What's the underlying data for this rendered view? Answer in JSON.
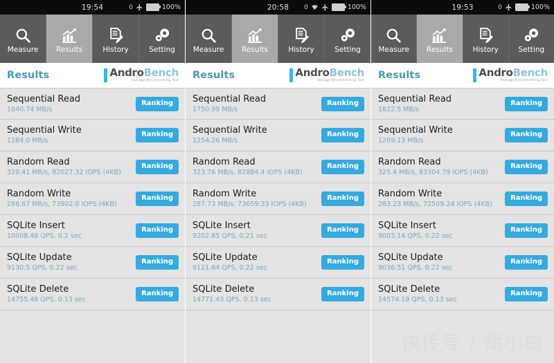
{
  "app": {
    "title": "Results",
    "logo": {
      "part1": "Andro",
      "part2": "Bench",
      "tagline": "Storage Benchmarking Tool",
      "bar_color": "#38b8e0",
      "part1_color": "#4c4c4c",
      "part2_color": "#8fc6dd"
    },
    "accent_color": "#35aade",
    "title_color": "#4a9ab0",
    "value_color": "#79a9c4",
    "tab_active_bg": "#a9a9a9",
    "tab_bg": "#5b5b5b",
    "list_bg": "#e4e4e4"
  },
  "tabs": [
    {
      "label": "Measure",
      "icon": "search-icon",
      "active": false
    },
    {
      "label": "Results",
      "icon": "bar-chart-icon",
      "active": true
    },
    {
      "label": "History",
      "icon": "document-pen-icon",
      "active": false
    },
    {
      "label": "Setting",
      "icon": "gears-icon",
      "active": false
    }
  ],
  "ranking_label": "Ranking",
  "watermark": "快传号 / 胡小白",
  "panels": [
    {
      "status": {
        "time": "19:54",
        "zero": "0",
        "wifi": false,
        "airplane": true,
        "battery": "100%"
      },
      "rows": [
        {
          "title": "Sequential Read",
          "value": "1840.74 MB/s"
        },
        {
          "title": "Sequential Write",
          "value": "1284.0 MB/s"
        },
        {
          "title": "Random Read",
          "value": "320.41 MB/s, 82027.32 IOPS (4KB)"
        },
        {
          "title": "Random Write",
          "value": "288.67 MB/s, 73902.0 IOPS (4KB)"
        },
        {
          "title": "SQLite Insert",
          "value": "10008.48 QPS, 0.2 sec"
        },
        {
          "title": "SQLite Update",
          "value": "9130.5 QPS, 0.22 sec"
        },
        {
          "title": "SQLite Delete",
          "value": "14755.48 QPS, 0.13 sec"
        }
      ]
    },
    {
      "status": {
        "time": "20:58",
        "zero": "0",
        "wifi": true,
        "airplane": true,
        "battery": "100%"
      },
      "rows": [
        {
          "title": "Sequential Read",
          "value": "1750.99 MB/s"
        },
        {
          "title": "Sequential Write",
          "value": "1254.26 MB/s"
        },
        {
          "title": "Random Read",
          "value": "323.76 MB/s, 82884.4 IOPS (4KB)"
        },
        {
          "title": "Random Write",
          "value": "287.73 MB/s, 73659.33 IOPS (4KB)"
        },
        {
          "title": "SQLite Insert",
          "value": "9202.85 QPS, 0.21 sec"
        },
        {
          "title": "SQLite Update",
          "value": "9121.64 QPS, 0.22 sec"
        },
        {
          "title": "SQLite Delete",
          "value": "14771.43 QPS, 0.13 sec"
        }
      ]
    },
    {
      "status": {
        "time": "19:53",
        "zero": "0",
        "wifi": false,
        "airplane": true,
        "battery": "100%"
      },
      "rows": [
        {
          "title": "Sequential Read",
          "value": "1822.5 MB/s"
        },
        {
          "title": "Sequential Write",
          "value": "1269.13 MB/s"
        },
        {
          "title": "Random Read",
          "value": "325.4 MB/s, 83304.79 IOPS (4KB)"
        },
        {
          "title": "Random Write",
          "value": "283.23 MB/s, 72509.24 IOPS (4KB)"
        },
        {
          "title": "SQLite Insert",
          "value": "9003.14 QPS, 0.22 sec"
        },
        {
          "title": "SQLite Update",
          "value": "9036.51 QPS, 0.22 sec"
        },
        {
          "title": "SQLite Delete",
          "value": "14574.19 QPS, 0.13 sec"
        }
      ]
    }
  ]
}
